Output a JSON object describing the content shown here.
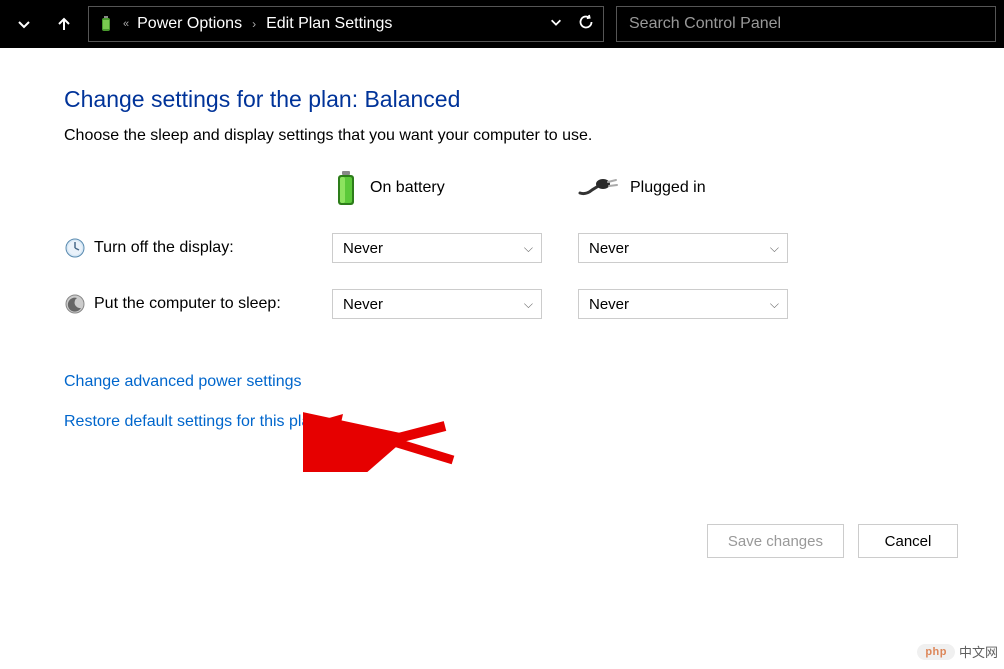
{
  "breadcrumb": {
    "part1": "Power Options",
    "part2": "Edit Plan Settings"
  },
  "search": {
    "placeholder": "Search Control Panel"
  },
  "heading": "Change settings for the plan: Balanced",
  "subheading": "Choose the sleep and display settings that you want your computer to use.",
  "columns": {
    "battery": "On battery",
    "plugged": "Plugged in"
  },
  "rows": {
    "display": {
      "label": "Turn off the display:",
      "battery_value": "Never",
      "plugged_value": "Never"
    },
    "sleep": {
      "label": "Put the computer to sleep:",
      "battery_value": "Never",
      "plugged_value": "Never"
    }
  },
  "links": {
    "advanced": "Change advanced power settings",
    "restore": "Restore default settings for this plan"
  },
  "buttons": {
    "save": "Save changes",
    "cancel": "Cancel"
  },
  "watermark": {
    "logo": "php",
    "text": "中文网"
  }
}
